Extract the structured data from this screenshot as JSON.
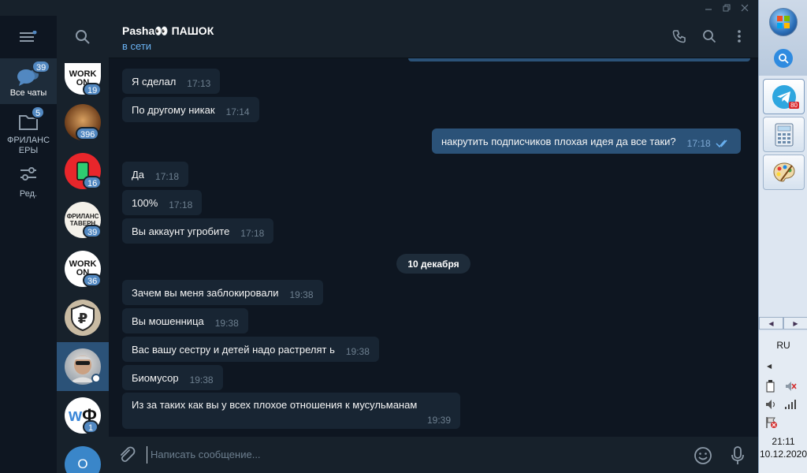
{
  "window": {
    "minimize_icon": "minimize-icon",
    "maximize_icon": "restore-icon",
    "close_icon": "close-icon"
  },
  "folders": {
    "items": [
      {
        "label": "Все чаты",
        "badge": "39",
        "icon": "chats-icon",
        "active": true
      },
      {
        "label": "ФРИЛАНС ЕРЫ",
        "badge": "5",
        "icon": "folder-icon",
        "active": false
      },
      {
        "label": "Ред.",
        "badge": "",
        "icon": "filter-settings-icon",
        "active": false
      }
    ]
  },
  "chatlist": {
    "avatars": [
      {
        "name": "WORK ON",
        "badge": "19"
      },
      {
        "name": "group",
        "badge": "396"
      },
      {
        "name": "red-phone",
        "badge": "16"
      },
      {
        "name": "ФРИЛАНС ТАВЕРНА",
        "badge": "39"
      },
      {
        "name": "WORK ON",
        "badge": "36"
      },
      {
        "name": "ruble",
        "badge": ""
      },
      {
        "name": "Pasha",
        "badge": ""
      },
      {
        "name": "WФ",
        "badge": "1"
      },
      {
        "name": "О",
        "badge": ""
      }
    ]
  },
  "chat": {
    "name": "Pasha👀 ПАШОК",
    "status": "в сети"
  },
  "messages": [
    {
      "text": "Я сделал",
      "time": "17:13",
      "out": false
    },
    {
      "text": "По другому никак",
      "time": "17:14",
      "out": false
    },
    {
      "text": "накрутить подписчиков плохая идея да все таки?",
      "time": "17:18",
      "out": true
    },
    {
      "text": "Да",
      "time": "17:18",
      "out": false
    },
    {
      "text": "100%",
      "time": "17:18",
      "out": false
    },
    {
      "text": "Вы аккаунт угробите",
      "time": "17:18",
      "out": false
    },
    {
      "text": "Зачем вы меня заблокировали",
      "time": "19:38",
      "out": false
    },
    {
      "text": "Вы мошенница",
      "time": "19:38",
      "out": false
    },
    {
      "text": "Вас вашу сестру и детей надо растрелят ь",
      "time": "19:38",
      "out": false
    },
    {
      "text": "Биомусор",
      "time": "19:38",
      "out": false
    },
    {
      "text": "Из за таких как вы у всех плохое отношения к мусульманам",
      "time": "19:39",
      "out": false
    }
  ],
  "date_separator": "10 декабря",
  "compose": {
    "placeholder": "Написать сообщение..."
  },
  "taskbar": {
    "telegram_badge": "80",
    "language": "RU",
    "time": "21:11",
    "date": "10.12.2020"
  },
  "colors": {
    "background": "#0e1621",
    "panel": "#17212b",
    "incoming": "#182533",
    "outgoing": "#2b5278",
    "accent": "#5288c1",
    "status": "#6ab2f2"
  }
}
